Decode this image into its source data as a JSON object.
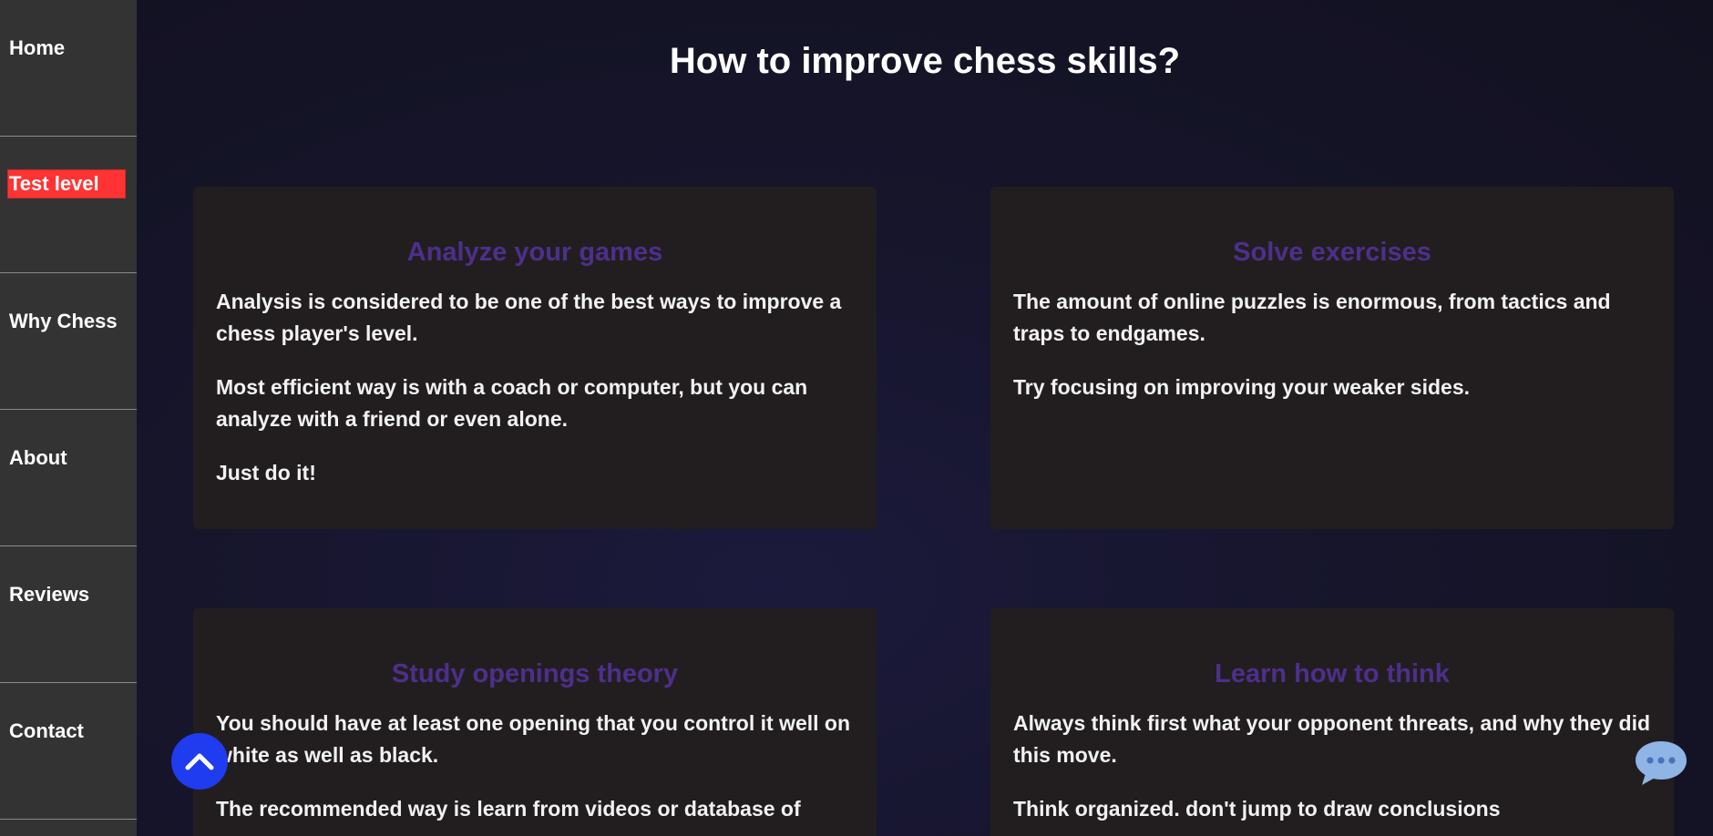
{
  "sidebar": {
    "items": [
      {
        "label": "Home",
        "active": false
      },
      {
        "label": "Test level",
        "active": true
      },
      {
        "label": "Why Chess",
        "active": false
      },
      {
        "label": "About",
        "active": false
      },
      {
        "label": "Reviews",
        "active": false
      },
      {
        "label": "Contact",
        "active": false
      }
    ]
  },
  "main": {
    "title": "How to improve chess skills?",
    "cards": [
      {
        "title": "Analyze your games",
        "paragraphs": [
          "Analysis is considered to be one of the best ways to improve a chess player's level.",
          "Most efficient way is with a coach or computer, but you can analyze with a friend or even alone.",
          "Just do it!"
        ]
      },
      {
        "title": "Solve exercises",
        "paragraphs": [
          "The amount of online puzzles is enormous, from tactics and traps to endgames.",
          "Try focusing on improving your weaker sides."
        ]
      },
      {
        "title": "Study openings theory",
        "paragraphs": [
          "You should have at least one opening that you control it well on white as well as black.",
          "The recommended way is learn from videos or database of"
        ]
      },
      {
        "title": "Learn how to think",
        "paragraphs": [
          "Always think first what your opponent threats, and why they did this move.",
          "Think organized. don't jump to draw conclusions"
        ]
      }
    ]
  },
  "controls": {
    "scroll_top_icon": "chevron-up-icon",
    "chat_icon": "chat-bubble-icon"
  },
  "colors": {
    "sidebar_bg": "#333333",
    "active_nav_bg": "#ff3333",
    "card_bg": "#221e1f",
    "card_title": "#4d2f8c",
    "scroll_top_bg": "#1f3cf0",
    "chat_bubble": "#8fb4e6"
  }
}
